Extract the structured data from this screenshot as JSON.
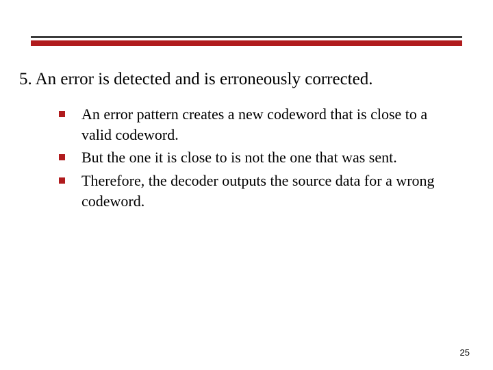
{
  "colors": {
    "accent": "#b01b1d",
    "rule_thin": "#000000",
    "text": "#000000"
  },
  "heading": {
    "text": "5. An error is detected and is erroneously corrected."
  },
  "bullets": {
    "items": [
      {
        "text": "An error pattern creates a new codeword that is close to a valid codeword."
      },
      {
        "text": "But the one it is close to is not the one that was sent."
      },
      {
        "text": "Therefore, the decoder outputs the source data for a wrong codeword."
      }
    ]
  },
  "page_number": "25"
}
